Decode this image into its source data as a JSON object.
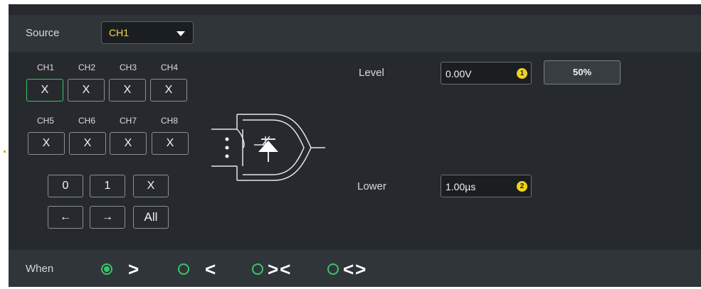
{
  "source": {
    "label": "Source",
    "value": "CH1"
  },
  "channels": {
    "row1": [
      {
        "label": "CH1",
        "value": "X",
        "active": true
      },
      {
        "label": "CH2",
        "value": "X",
        "active": false
      },
      {
        "label": "CH3",
        "value": "X",
        "active": false
      },
      {
        "label": "CH4",
        "value": "X",
        "active": false
      }
    ],
    "row2": [
      {
        "label": "CH5",
        "value": "X",
        "active": false
      },
      {
        "label": "CH6",
        "value": "X",
        "active": false
      },
      {
        "label": "CH7",
        "value": "X",
        "active": false
      },
      {
        "label": "CH8",
        "value": "X",
        "active": false
      }
    ]
  },
  "bit_buttons": {
    "zero": "0",
    "one": "1",
    "x": "X",
    "left": "←",
    "right": "→",
    "all": "All"
  },
  "level": {
    "label": "Level",
    "value": "0.00V",
    "badge": "1",
    "percent_button": "50%"
  },
  "lower": {
    "label": "Lower",
    "value": "1.00µs",
    "badge": "2"
  },
  "when": {
    "label": "When",
    "options": [
      {
        "symbol": ">",
        "checked": true
      },
      {
        "symbol": "<",
        "checked": false
      },
      {
        "symbol": "><",
        "checked": false
      },
      {
        "symbol": "<>",
        "checked": false
      }
    ]
  },
  "colors": {
    "accent": "#3cc46a",
    "badge": "#f0d31d",
    "source_value": "#f3d84a",
    "panel": "#262a2e",
    "row": "#30353a"
  },
  "icons": {
    "select_caret": "caret-down-icon",
    "logic_gate": "and-gate-diode-icon",
    "badges": "number-badge-icon"
  }
}
